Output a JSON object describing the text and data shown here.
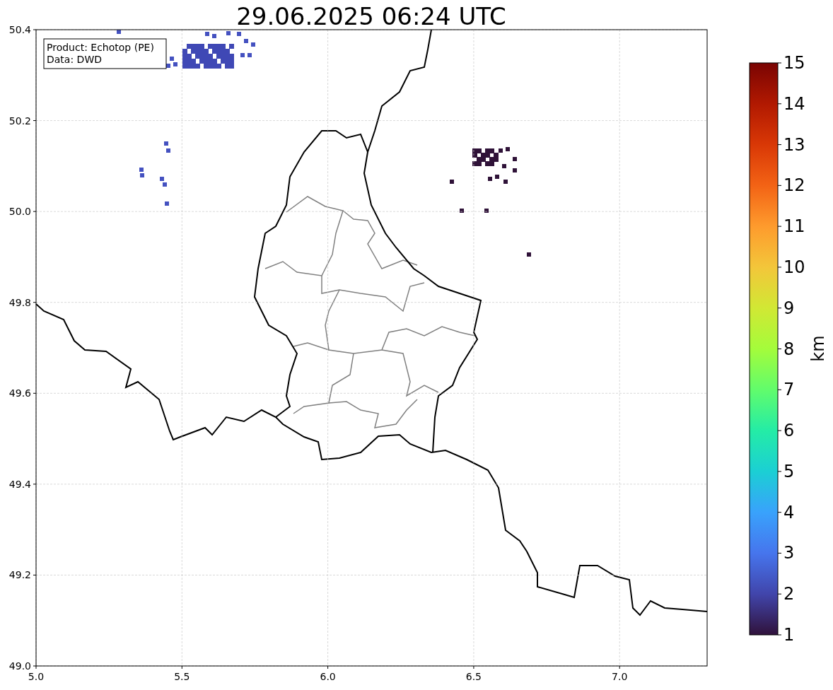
{
  "title": "29.06.2025 06:24 UTC",
  "info_box": {
    "lines": [
      "Product: Echotop (PE)",
      "Data: DWD"
    ]
  },
  "x_axis": {
    "ticks": [
      "5.0",
      "5.5",
      "6.0",
      "6.5",
      "7.0"
    ]
  },
  "y_axis": {
    "ticks": [
      "50.4",
      "50.2",
      "50.0",
      "49.8",
      "49.6",
      "49.4",
      "49.2",
      "49.0"
    ]
  },
  "colorbar": {
    "label": "km",
    "ticks": [
      "15",
      "14",
      "13",
      "12",
      "11",
      "10",
      "9",
      "8",
      "7",
      "6",
      "5",
      "4",
      "3",
      "2",
      "1"
    ]
  }
}
